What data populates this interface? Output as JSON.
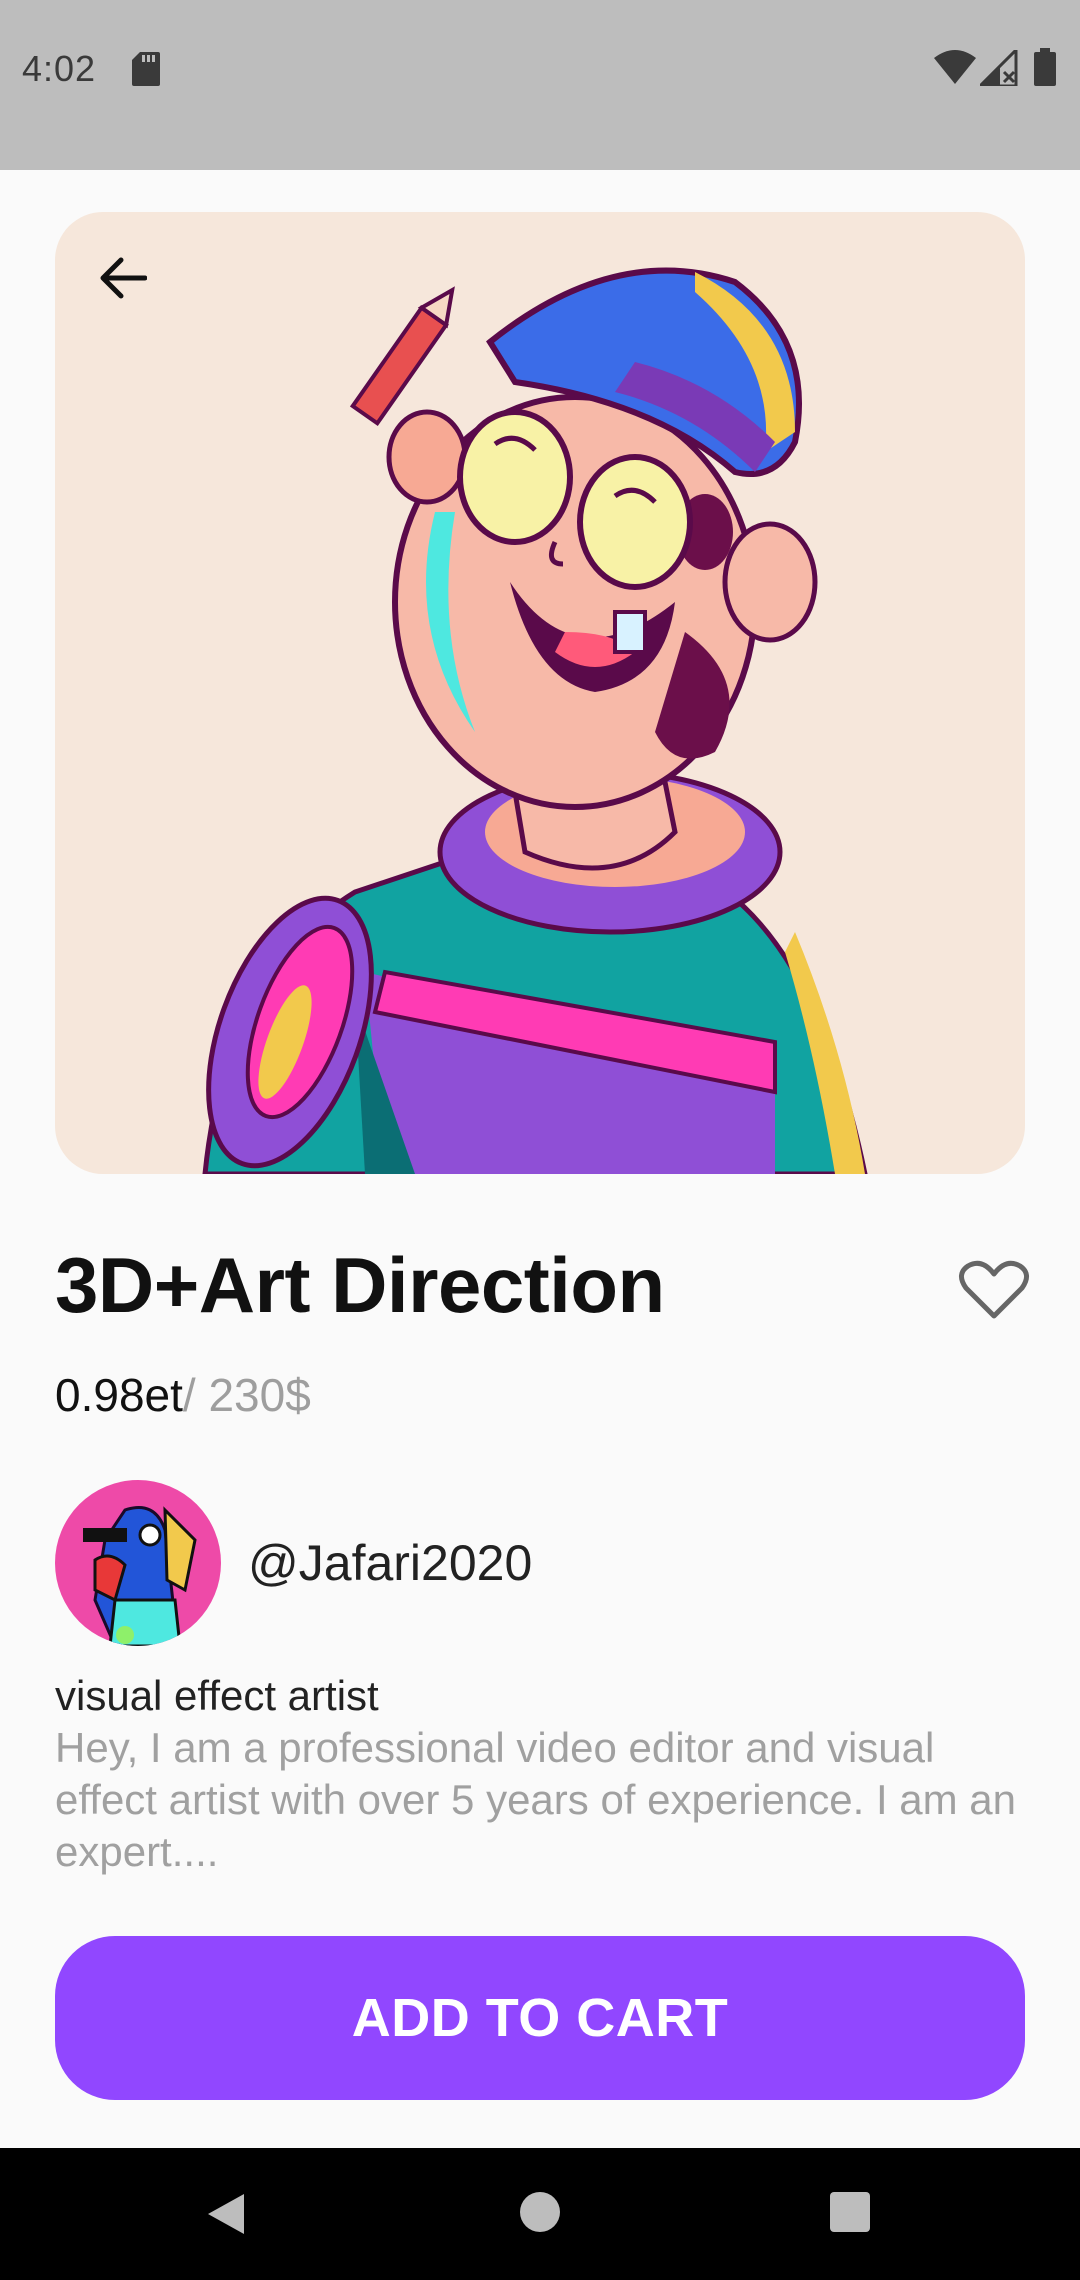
{
  "status_bar": {
    "time": "4:02",
    "icons": [
      "sd-card-icon",
      "wifi-icon",
      "signal-icon",
      "battery-icon"
    ]
  },
  "product": {
    "title": "3D+Art Direction",
    "price_eth": "0.98et",
    "price_usd": "/ 230$",
    "hero_image": "cartoon-character-with-pencil-illustration",
    "hero_bg_color": "#f6e7db"
  },
  "creator": {
    "username": "@Jafari2020",
    "role": "visual effect artist",
    "bio": "Hey, I am a professional video editor and visual effect artist with over 5 years of experience. I am an expert...."
  },
  "actions": {
    "add_to_cart": "ADD TO CART",
    "accent_color": "#9147ff"
  },
  "nav": {
    "icons": [
      "back-triangle-icon",
      "home-circle-icon",
      "recents-square-icon"
    ]
  }
}
